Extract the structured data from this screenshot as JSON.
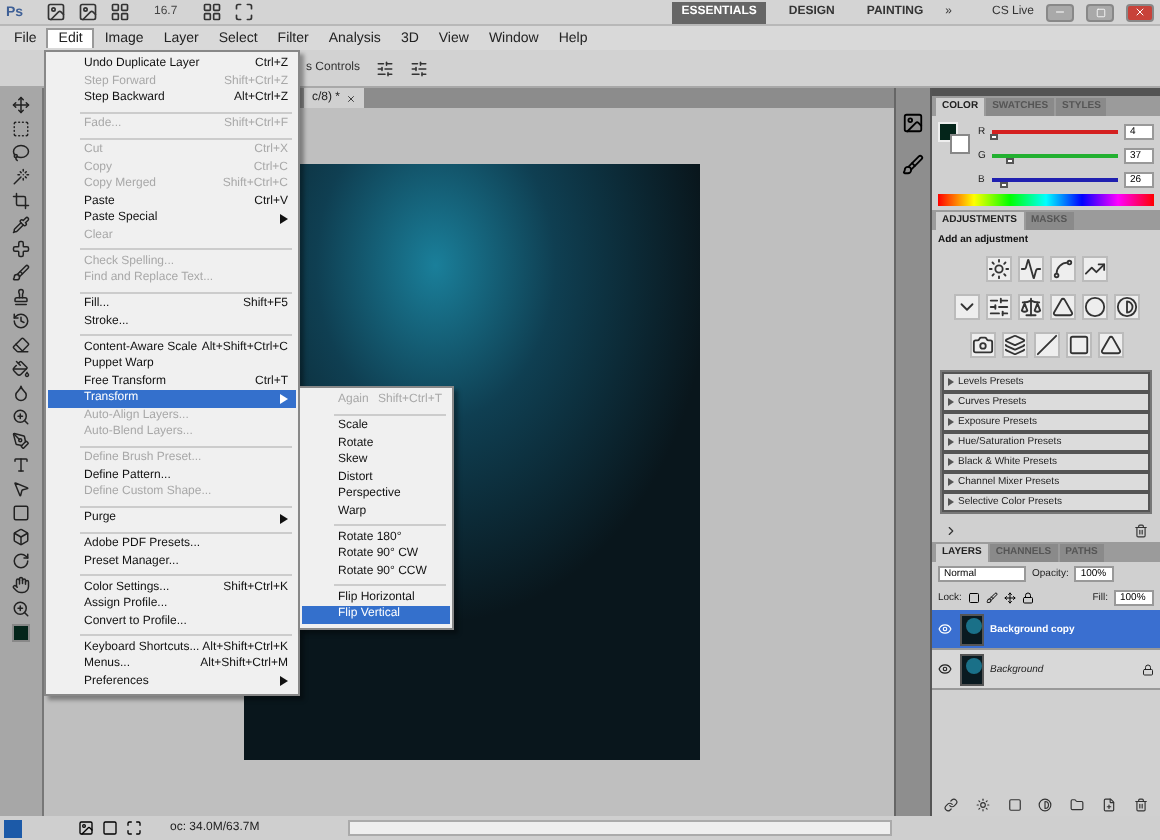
{
  "app_bar": {
    "logo": "Ps",
    "zoom": "16.7",
    "workspaces": [
      {
        "label": "ESSENTIALS",
        "selected": true
      },
      {
        "label": "DESIGN",
        "selected": false
      },
      {
        "label": "PAINTING",
        "selected": false
      }
    ],
    "more": "»",
    "cs_live": "CS Live"
  },
  "menu_bar": [
    {
      "label": "File",
      "selected": false
    },
    {
      "label": "Edit",
      "selected": true
    },
    {
      "label": "Image",
      "selected": false
    },
    {
      "label": "Layer",
      "selected": false
    },
    {
      "label": "Select",
      "selected": false
    },
    {
      "label": "Filter",
      "selected": false
    },
    {
      "label": "Analysis",
      "selected": false
    },
    {
      "label": "3D",
      "selected": false
    },
    {
      "label": "View",
      "selected": false
    },
    {
      "label": "Window",
      "selected": false
    },
    {
      "label": "Help",
      "selected": false
    }
  ],
  "options_bar": {
    "checkbox_label": "s Controls"
  },
  "document": {
    "tab": "c/8) *"
  },
  "edit_menu": [
    {
      "kind": "item",
      "label": "Undo Duplicate Layer",
      "shortcut": "Ctrl+Z",
      "disabled": false,
      "selected": false
    },
    {
      "kind": "item",
      "label": "Step Forward",
      "shortcut": "Shift+Ctrl+Z",
      "disabled": true,
      "selected": false
    },
    {
      "kind": "item",
      "label": "Step Backward",
      "shortcut": "Alt+Ctrl+Z",
      "disabled": false,
      "selected": false
    },
    {
      "kind": "separator"
    },
    {
      "kind": "item",
      "label": "Fade...",
      "shortcut": "Shift+Ctrl+F",
      "disabled": true,
      "selected": false
    },
    {
      "kind": "separator"
    },
    {
      "kind": "item",
      "label": "Cut",
      "shortcut": "Ctrl+X",
      "disabled": true,
      "selected": false
    },
    {
      "kind": "item",
      "label": "Copy",
      "shortcut": "Ctrl+C",
      "disabled": true,
      "selected": false
    },
    {
      "kind": "item",
      "label": "Copy Merged",
      "shortcut": "Shift+Ctrl+C",
      "disabled": true,
      "selected": false
    },
    {
      "kind": "item",
      "label": "Paste",
      "shortcut": "Ctrl+V",
      "disabled": false,
      "selected": false
    },
    {
      "kind": "submenu",
      "label": "Paste Special",
      "disabled": false,
      "selected": false
    },
    {
      "kind": "item",
      "label": "Clear",
      "disabled": true,
      "selected": false
    },
    {
      "kind": "separator"
    },
    {
      "kind": "item",
      "label": "Check Spelling...",
      "disabled": true,
      "selected": false
    },
    {
      "kind": "item",
      "label": "Find and Replace Text...",
      "disabled": true,
      "selected": false
    },
    {
      "kind": "separator"
    },
    {
      "kind": "item",
      "label": "Fill...",
      "shortcut": "Shift+F5",
      "disabled": false,
      "selected": false
    },
    {
      "kind": "item",
      "label": "Stroke...",
      "disabled": false,
      "selected": false
    },
    {
      "kind": "separator"
    },
    {
      "kind": "item",
      "label": "Content-Aware Scale",
      "shortcut": "Alt+Shift+Ctrl+C",
      "disabled": false,
      "selected": false
    },
    {
      "kind": "item",
      "label": "Puppet Warp",
      "disabled": false,
      "selected": false
    },
    {
      "kind": "item",
      "label": "Free Transform",
      "shortcut": "Ctrl+T",
      "disabled": false,
      "selected": false
    },
    {
      "kind": "submenu",
      "label": "Transform",
      "disabled": false,
      "selected": true
    },
    {
      "kind": "item",
      "label": "Auto-Align Layers...",
      "disabled": true,
      "selected": false
    },
    {
      "kind": "item",
      "label": "Auto-Blend Layers...",
      "disabled": true,
      "selected": false
    },
    {
      "kind": "separator"
    },
    {
      "kind": "item",
      "label": "Define Brush Preset...",
      "disabled": true,
      "selected": false
    },
    {
      "kind": "item",
      "label": "Define Pattern...",
      "disabled": false,
      "selected": false
    },
    {
      "kind": "item",
      "label": "Define Custom Shape...",
      "disabled": true,
      "selected": false
    },
    {
      "kind": "separator"
    },
    {
      "kind": "submenu",
      "label": "Purge",
      "disabled": false,
      "selected": false
    },
    {
      "kind": "separator"
    },
    {
      "kind": "item",
      "label": "Adobe PDF Presets...",
      "disabled": false,
      "selected": false
    },
    {
      "kind": "item",
      "label": "Preset Manager...",
      "disabled": false,
      "selected": false
    },
    {
      "kind": "separator"
    },
    {
      "kind": "item",
      "label": "Color Settings...",
      "shortcut": "Shift+Ctrl+K",
      "disabled": false,
      "selected": false
    },
    {
      "kind": "item",
      "label": "Assign Profile...",
      "disabled": false,
      "selected": false
    },
    {
      "kind": "item",
      "label": "Convert to Profile...",
      "disabled": false,
      "selected": false
    },
    {
      "kind": "separator"
    },
    {
      "kind": "item",
      "label": "Keyboard Shortcuts...",
      "shortcut": "Alt+Shift+Ctrl+K",
      "disabled": false,
      "selected": false
    },
    {
      "kind": "item",
      "label": "Menus...",
      "shortcut": "Alt+Shift+Ctrl+M",
      "disabled": false,
      "selected": false
    },
    {
      "kind": "submenu",
      "label": "Preferences",
      "disabled": false,
      "selected": false
    }
  ],
  "transform_submenu": [
    {
      "kind": "item",
      "label": "Again",
      "shortcut": "Shift+Ctrl+T",
      "disabled": true,
      "selected": false
    },
    {
      "kind": "separator"
    },
    {
      "kind": "item",
      "label": "Scale",
      "disabled": false,
      "selected": false
    },
    {
      "kind": "item",
      "label": "Rotate",
      "disabled": false,
      "selected": false
    },
    {
      "kind": "item",
      "label": "Skew",
      "disabled": false,
      "selected": false
    },
    {
      "kind": "item",
      "label": "Distort",
      "disabled": false,
      "selected": false
    },
    {
      "kind": "item",
      "label": "Perspective",
      "disabled": false,
      "selected": false
    },
    {
      "kind": "item",
      "label": "Warp",
      "disabled": false,
      "selected": false
    },
    {
      "kind": "separator"
    },
    {
      "kind": "item",
      "label": "Rotate 180°",
      "disabled": false,
      "selected": false
    },
    {
      "kind": "item",
      "label": "Rotate 90° CW",
      "disabled": false,
      "selected": false
    },
    {
      "kind": "item",
      "label": "Rotate 90° CCW",
      "disabled": false,
      "selected": false
    },
    {
      "kind": "separator"
    },
    {
      "kind": "item",
      "label": "Flip Horizontal",
      "disabled": false,
      "selected": false
    },
    {
      "kind": "item",
      "label": "Flip Vertical",
      "disabled": false,
      "selected": true
    }
  ],
  "color_panel": {
    "tabs": [
      {
        "label": "COLOR",
        "selected": true
      },
      {
        "label": "SWATCHES",
        "selected": false
      },
      {
        "label": "STYLES",
        "selected": false
      }
    ],
    "channels": [
      {
        "name": "R",
        "value": "4",
        "level": 0.016,
        "color": "#d42020"
      },
      {
        "name": "G",
        "value": "37",
        "level": 0.145,
        "color": "#22b030"
      },
      {
        "name": "B",
        "value": "26",
        "level": 0.102,
        "color": "#2020b0"
      }
    ]
  },
  "adjustments_panel": {
    "tabs": [
      {
        "label": "ADJUSTMENTS",
        "selected": true
      },
      {
        "label": "MASKS",
        "selected": false
      }
    ],
    "heading": "Add an adjustment",
    "presets": [
      "Levels Presets",
      "Curves Presets",
      "Exposure Presets",
      "Hue/Saturation Presets",
      "Black & White Presets",
      "Channel Mixer Presets",
      "Selective Color Presets"
    ]
  },
  "layers_panel": {
    "tabs": [
      {
        "label": "LAYERS",
        "selected": true
      },
      {
        "label": "CHANNELS",
        "selected": false
      },
      {
        "label": "PATHS",
        "selected": false
      }
    ],
    "blend_mode": "Normal",
    "opacity_label": "Opacity:",
    "opacity": "100%",
    "lock_label": "Lock:",
    "fill_label": "Fill:",
    "fill": "100%",
    "layers": [
      {
        "name": "Background copy",
        "selected": true,
        "locked": false,
        "visible": true
      },
      {
        "name": "Background",
        "selected": false,
        "locked": true,
        "visible": true
      }
    ]
  },
  "status_bar": {
    "doc_size": "oc: 34.0M/63.7M"
  }
}
